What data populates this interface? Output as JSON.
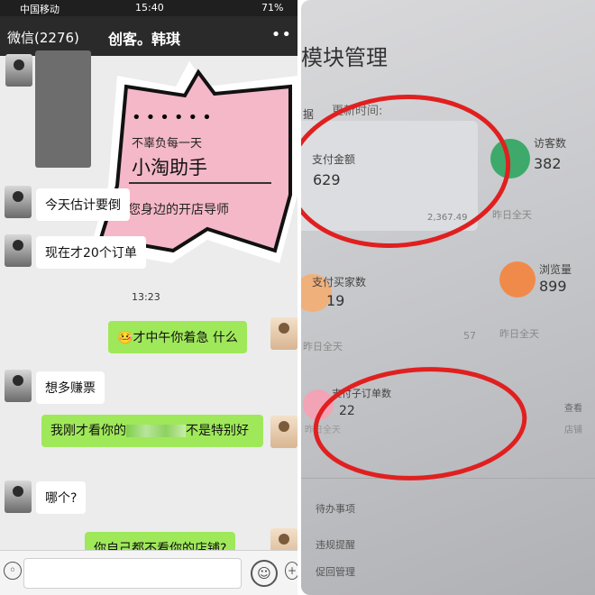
{
  "status_bar": {
    "carrier": "中国移动",
    "time": "15:40",
    "battery": "71%"
  },
  "chat": {
    "back_label": "微信(2276)",
    "contact_name": "创客。韩琪",
    "menu_icon": "more-dots-icon",
    "poster": {
      "dots": "••••••",
      "slogan": "不辜负每一天",
      "name": "小淘助手",
      "subtitle": "您身边的开店导师"
    },
    "messages": [
      {
        "from": "contact",
        "text": "今天估计要倒"
      },
      {
        "from": "contact",
        "text": "现在才20个订单"
      },
      {
        "from": "me",
        "text": "才中午你着急 什么"
      },
      {
        "from": "contact",
        "text": "想多赚票"
      },
      {
        "from": "me",
        "text_before": "我刚才看你的",
        "text_after": "不是特别好"
      },
      {
        "from": "contact",
        "text": "哪个?"
      },
      {
        "from": "me",
        "text": "你自己都不看你的店铺?"
      }
    ],
    "timestamp": "13:23",
    "emoji": "🤒"
  },
  "dashboard": {
    "title": "模块管理",
    "tab_partial": "据",
    "updated_label": "更新时间:",
    "metrics": [
      {
        "label": "支付金额",
        "value": "629",
        "sub": "2,367.49",
        "color": "#e9eef7"
      },
      {
        "label": "访客数",
        "value": "382",
        "sub": "昨日全天",
        "color": "#3daa6c"
      },
      {
        "label": "支付买家数",
        "value": "19",
        "sub": "昨日全天",
        "extra": "57",
        "color": "#f0b07b"
      },
      {
        "label": "浏览量",
        "value": "899",
        "sub": "昨日全天",
        "color": "#f08a4b"
      },
      {
        "label": "支付子订单数",
        "value": "22",
        "sub": "昨日全天",
        "color": "#f2a3b5"
      }
    ],
    "side_labels": [
      "查看",
      "店铺"
    ],
    "menu": [
      "待办事项",
      "违规提醒",
      "促回管理"
    ]
  }
}
